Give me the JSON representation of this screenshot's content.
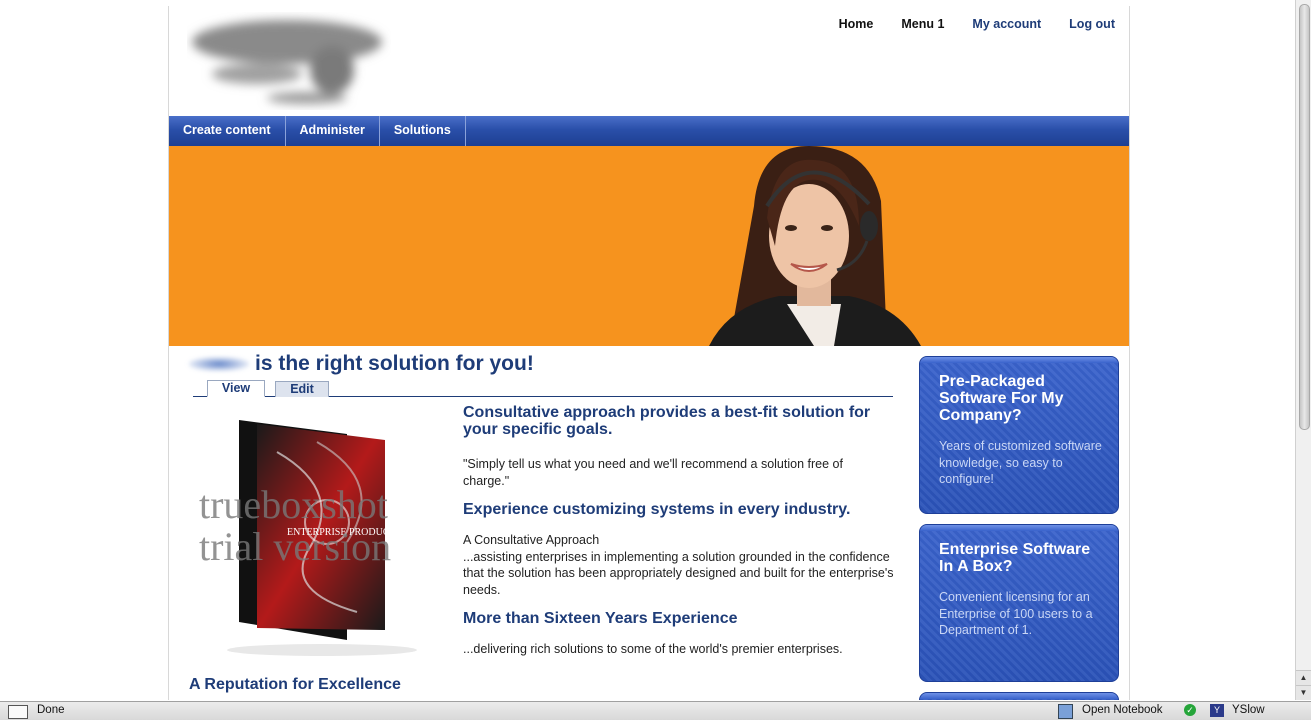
{
  "header": {
    "top_links": [
      {
        "label": "Home",
        "style": "dark"
      },
      {
        "label": "Menu 1",
        "style": "dark"
      },
      {
        "label": "My account",
        "style": "blue"
      },
      {
        "label": "Log out",
        "style": "blue"
      }
    ]
  },
  "nav": {
    "items": [
      "Create content",
      "Administer",
      "Solutions"
    ]
  },
  "colors": {
    "brand_blue": "#1e3c78",
    "nav_blue": "#2a4fa9",
    "banner_orange": "#f6931e"
  },
  "main": {
    "title_suffix": "is the right solution for you!",
    "tabs": {
      "view": "View",
      "edit": "Edit"
    },
    "boxshot": {
      "watermark_line1": "trueboxshot",
      "watermark_line2": "trial version",
      "product_label": "ENTERPRISE PRODUCT"
    },
    "sections": {
      "h1": "Consultative approach provides a best-fit solution for your specific goals.",
      "p1": "\"Simply tell us what you need and we'll recommend a solution free of charge.\"",
      "h2": "Experience customizing systems in every industry.",
      "p2a": "A Consultative Approach",
      "p2b": "...assisting enterprises in implementing a solution grounded in the confidence that the solution has been appropriately designed and built for the enterprise's needs.",
      "h3": "More than Sixteen Years Experience",
      "p3": "...delivering rich solutions to some of the world's premier enterprises."
    },
    "bottom_heading": "A Reputation for Excellence"
  },
  "sidebar": {
    "boxes": [
      {
        "title": "Pre-Packaged Software For My Company?",
        "text": "Years of customized software knowledge, so easy to configure!"
      },
      {
        "title": "Enterprise Software In A Box?",
        "text": "Convenient licensing for an Enterprise of 100 users to a Department of 1."
      }
    ]
  },
  "statusbar": {
    "status": "Done",
    "notebook": "Open Notebook",
    "yslow": "YSlow"
  }
}
